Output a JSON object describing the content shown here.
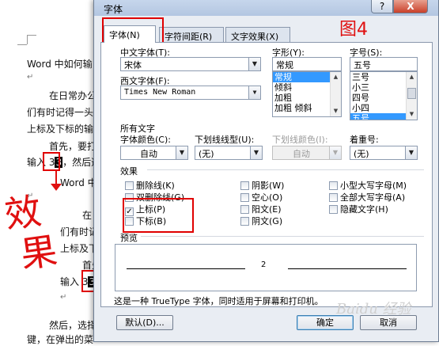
{
  "document": {
    "lines": [
      "Word 中如何输",
      "在日常办公",
      "们有时记得一头",
      "上标及下标的输",
      "首先，要打",
      "输入 3",
      "，然后选",
      "Word 中",
      "在日",
      "们有时记",
      "上标及下",
      "首先",
      "输入 3",
      "然后，选择",
      "键，在弹出的菜"
    ],
    "selected_char": "3",
    "selected_char2": "3",
    "handwriting_1": "效",
    "handwriting_2": "果"
  },
  "annotation": {
    "label": "图4",
    "color": "#e01010"
  },
  "dialog": {
    "title": "字体",
    "help_label": "?",
    "close_label": "X",
    "tabs": [
      {
        "label": "字体(N)",
        "active": true
      },
      {
        "label": "字符间距(R)",
        "active": false
      },
      {
        "label": "文字效果(X)",
        "active": false
      }
    ],
    "chinese_font": {
      "label": "中文字体(T):",
      "value": "宋体"
    },
    "western_font": {
      "label": "西文字体(F):",
      "value": "Times New Roman"
    },
    "font_style": {
      "label": "字形(Y):",
      "value": "常规",
      "options": [
        "常规",
        "倾斜",
        "加粗",
        "加粗 倾斜"
      ],
      "selected_index": 0
    },
    "font_size": {
      "label": "字号(S):",
      "value": "五号",
      "options": [
        "三号",
        "小三",
        "四号",
        "小四",
        "五号"
      ],
      "selected_index": 4
    },
    "all_text_heading": "所有文字",
    "font_color": {
      "label": "字体颜色(C):",
      "value": "自动"
    },
    "underline_style": {
      "label": "下划线线型(U):",
      "value": "(无)"
    },
    "underline_color": {
      "label": "下划线颜色(I):",
      "value": "自动"
    },
    "emphasis": {
      "label": "着重号:",
      "value": "(无)"
    },
    "effects_heading": "效果",
    "effects": {
      "col1": [
        {
          "label": "删除线(K)",
          "checked": false
        },
        {
          "label": "双删除线(G)",
          "checked": false
        },
        {
          "label": "上标(P)",
          "checked": true
        },
        {
          "label": "下标(B)",
          "checked": false
        }
      ],
      "col2": [
        {
          "label": "阴影(W)",
          "checked": false
        },
        {
          "label": "空心(O)",
          "checked": false
        },
        {
          "label": "阳文(E)",
          "checked": false
        },
        {
          "label": "阴文(G)",
          "checked": false
        }
      ],
      "col3": [
        {
          "label": "小型大写字母(M)",
          "checked": false
        },
        {
          "label": "全部大写字母(A)",
          "checked": false
        },
        {
          "label": "隐藏文字(H)",
          "checked": false
        }
      ]
    },
    "check_mark": "✓",
    "preview_heading": "预览",
    "preview_sample": "2",
    "info_text": "这是一种 TrueType 字体，同时适用于屏幕和打印机。",
    "default_button": "默认(D)...",
    "ok_button": "确定",
    "cancel_button": "取消"
  },
  "watermark": "Baidu 经验"
}
